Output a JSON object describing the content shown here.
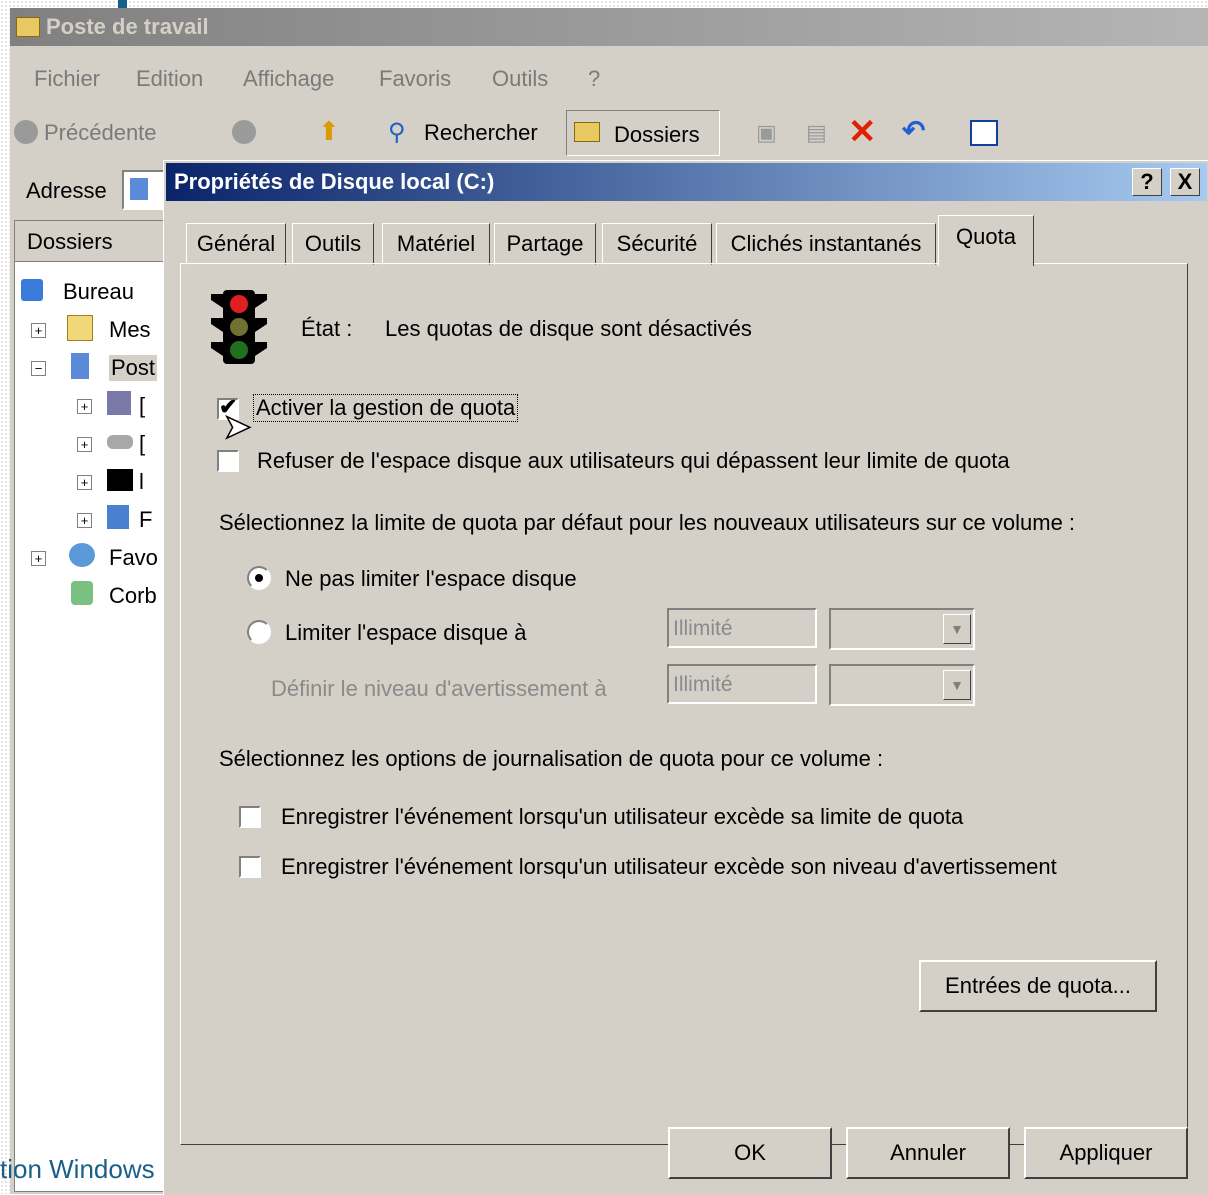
{
  "explorer": {
    "title": "Poste de travail",
    "menu": [
      "Fichier",
      "Edition",
      "Affichage",
      "Favoris",
      "Outils",
      "?"
    ],
    "toolbar": {
      "back": "Précédente",
      "search": "Rechercher",
      "folders": "Dossiers"
    },
    "address_label": "Adresse",
    "tree_header": "Dossiers",
    "tree_items": [
      "Bureau",
      "Mes",
      "Post",
      "Favo",
      "Corb"
    ],
    "tree_subitems": [
      "[",
      "[",
      "l",
      "F"
    ]
  },
  "bottom_caption": "tion Windows",
  "dialog": {
    "title": "Propriétés de Disque local (C:)",
    "help_button": "?",
    "close_button": "X",
    "tabs": [
      "Général",
      "Outils",
      "Matériel",
      "Partage",
      "Sécurité",
      "Clichés instantanés",
      "Quota"
    ],
    "active_tab": "Quota",
    "status_label": "État :",
    "status_value": "Les quotas de disque sont désactivés",
    "enable_quota": {
      "label": "Activer la gestion de quota",
      "checked": true
    },
    "deny_space": {
      "label": "Refuser de l'espace disque aux utilisateurs qui dépassent leur limite de quota",
      "checked": false
    },
    "default_limit_heading": "Sélectionnez la limite de quota par défaut pour les nouveaux utilisateurs sur ce volume :",
    "no_limit": {
      "label": "Ne pas limiter l'espace disque",
      "selected": true
    },
    "limit_to": {
      "label": "Limiter l'espace disque à",
      "value": "Illimité"
    },
    "warning_level": {
      "label": "Définir le niveau d'avertissement à",
      "value": "Illimité"
    },
    "logging_heading": "Sélectionnez les options de journalisation de quota pour ce volume :",
    "log_limit": {
      "label": "Enregistrer l'événement lorsqu'un utilisateur excède sa limite de quota",
      "checked": false
    },
    "log_warning": {
      "label": "Enregistrer l'événement lorsqu'un utilisateur excède son niveau d'avertissement",
      "checked": false
    },
    "quota_entries_button": "Entrées de quota...",
    "ok_button": "OK",
    "cancel_button": "Annuler",
    "apply_button": "Appliquer"
  }
}
